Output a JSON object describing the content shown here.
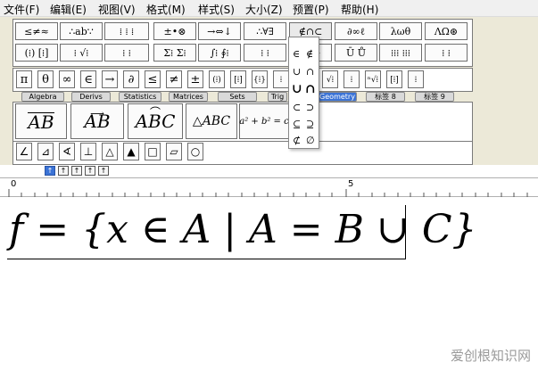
{
  "menu": [
    "文件(F)",
    "编辑(E)",
    "视图(V)",
    "格式(M)",
    "样式(S)",
    "大小(Z)",
    "预置(P)",
    "帮助(H)"
  ],
  "palette_row1": [
    "≤≠≈",
    "∴ab∵",
    "⁞ ⁞ ⁞",
    "±•⊗",
    "→⇔↓",
    "∴∀∃",
    "∉∩⊂",
    "∂∞ℓ",
    "λωθ",
    "ΛΩ⊛"
  ],
  "palette_row2": [
    "(⁞) [⁞]",
    "⁞ √⁞",
    "⁞ ⁞",
    "Σ⁞ Σ⁞",
    "∫⁞ ∮⁞",
    "⁞ ⁞",
    "→ ←",
    "Ū Ů",
    "⁞⁞⁞ ⁞⁞⁞",
    "⁞ ⁞"
  ],
  "symbols_row": [
    "π",
    "θ",
    "∞",
    "∈",
    "→",
    "∂",
    "≤",
    "≠",
    "±",
    "(⁞)",
    "[⁞]",
    "{⁞}",
    "⁞",
    "⁞",
    "√⁞",
    "⁞",
    "ⁿ√⁞",
    "[⁞]",
    "⁞",
    "⁞",
    "⁞"
  ],
  "tabs": [
    "Algebra",
    "Derivs",
    "Statistics",
    "Matrices",
    "Sets",
    "Trig",
    "Geometry",
    "标签 8",
    "标签 9"
  ],
  "active_tab": "Geometry",
  "templates": [
    "AB",
    "AB",
    "ABC",
    "△ABC",
    "a² + b² = c"
  ],
  "geometry_row": [
    "∠",
    "⊿",
    "∢",
    "⊥",
    "△",
    "▲",
    "□",
    "▱",
    "○"
  ],
  "dropdown_symbols": [
    "∈",
    "∉",
    "∪",
    "∩",
    "∪",
    "∩",
    "⊂",
    "⊃",
    "⊆",
    "⊇",
    "⊄",
    "∅"
  ],
  "align_buttons": [
    "↑",
    "↑",
    "↑",
    "↑",
    "↑"
  ],
  "ruler_labels": [
    "0",
    "5"
  ],
  "equation": "f = {x ∈ A | A = B ∪ C}",
  "watermark": "爱创根知识网",
  "colors": {
    "chrome": "#ece9d8",
    "accent": "#3b73d6",
    "border": "#6e6e6e"
  }
}
